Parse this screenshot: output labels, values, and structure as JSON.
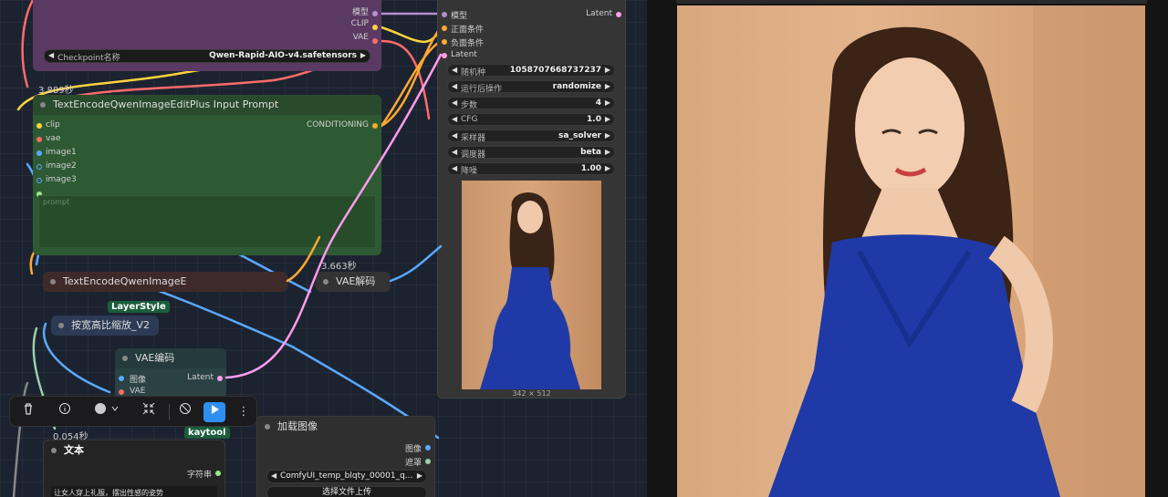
{
  "checkpoint_node": {
    "outputs": [
      "模型",
      "CLIP",
      "VAE"
    ],
    "widget_label": "Checkpoint名称",
    "widget_value": "Qwen-Rapid-AIO-v4.safetensors"
  },
  "text_encode_plus": {
    "timing": "3.889秒",
    "title": "TextEncodeQwenImageEditPlus Input Prompt",
    "inputs": [
      "clip",
      "vae",
      "image1",
      "image2",
      "image3"
    ],
    "output": "CONDITIONING",
    "prompt_placeholder": "prompt"
  },
  "text_encode": {
    "title": "TextEncodeQwenImageE"
  },
  "vae_decode": {
    "timing": "3.663秒",
    "title": "VAE解码"
  },
  "resize_node": {
    "badge": "LayerStyle",
    "title": "按宽高比缩放_V2"
  },
  "vae_encode": {
    "title": "VAE编码",
    "inputs": [
      "图像",
      "VAE"
    ],
    "output": "Latent"
  },
  "text_node": {
    "timing": "0.054秒",
    "badge": "kaytool",
    "title": "文本",
    "output": "字符串",
    "content": "让女人穿上礼服，摆出性感的姿势"
  },
  "load_image": {
    "title": "加载图像",
    "outputs": [
      "图像",
      "遮罩"
    ],
    "file_value": "ComfyUI_temp_blqty_00001_q...",
    "upload_button": "选择文件上传"
  },
  "ksampler": {
    "inputs": [
      "模型",
      "正面条件",
      "负面条件",
      "Latent"
    ],
    "output": "Latent",
    "widgets": [
      {
        "label": "随机种",
        "value": "1058707668737237"
      },
      {
        "label": "运行后操作",
        "value": "randomize"
      },
      {
        "label": "步数",
        "value": "4"
      },
      {
        "label": "CFG",
        "value": "1.0"
      },
      {
        "label": "采样器",
        "value": "sa_solver"
      },
      {
        "label": "调度器",
        "value": "beta"
      },
      {
        "label": "降噪",
        "value": "1.00"
      }
    ],
    "preview_size": "342 × 512"
  },
  "toolbar": {
    "icons": [
      "trash-icon",
      "info-icon",
      "color-icon",
      "collapse-icon",
      "bypass-icon",
      "play-icon",
      "more-icon"
    ]
  },
  "colors": {
    "canvas": "#1c2330",
    "checkpoint_node": "#5a3a63",
    "text_node_green": "#2e5a33",
    "play_blue": "#2e8ff0",
    "badge_green": "#1b5e3c"
  }
}
